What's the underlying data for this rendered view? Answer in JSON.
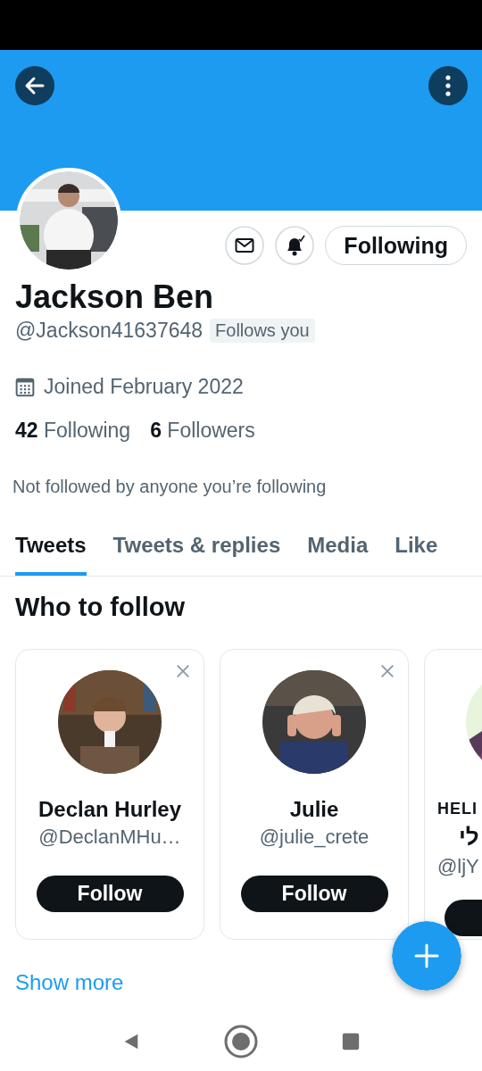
{
  "profile": {
    "name": "Jackson Ben",
    "handle": "@Jackson41637648",
    "follows_you": "Follows you",
    "joined": "Joined February 2022",
    "stats": [
      {
        "count": "42",
        "label": "Following"
      },
      {
        "count": "6",
        "label": "Followers"
      }
    ],
    "mutuals_note": "Not followed by anyone you’re following",
    "following_button": "Following",
    "notifications_on": true
  },
  "tabs": [
    {
      "label": "Tweets",
      "selected": true
    },
    {
      "label": "Tweets & replies",
      "selected": false
    },
    {
      "label": "Media",
      "selected": false
    },
    {
      "label": "Like",
      "selected": false
    }
  ],
  "who_to_follow": {
    "title": "Who to follow",
    "cards": [
      {
        "kind": "full",
        "name": "Declan Hurley",
        "handle": "@DeclanMHu…",
        "button": "Follow",
        "dismissible": true
      },
      {
        "kind": "full",
        "name": "Julie",
        "handle": "@julie_crete",
        "button": "Follow",
        "dismissible": true
      },
      {
        "kind": "cut",
        "name": "HELI",
        "name_2": "לי",
        "handle": "@ljY",
        "dismissible": false
      }
    ],
    "show_more": "Show more"
  }
}
